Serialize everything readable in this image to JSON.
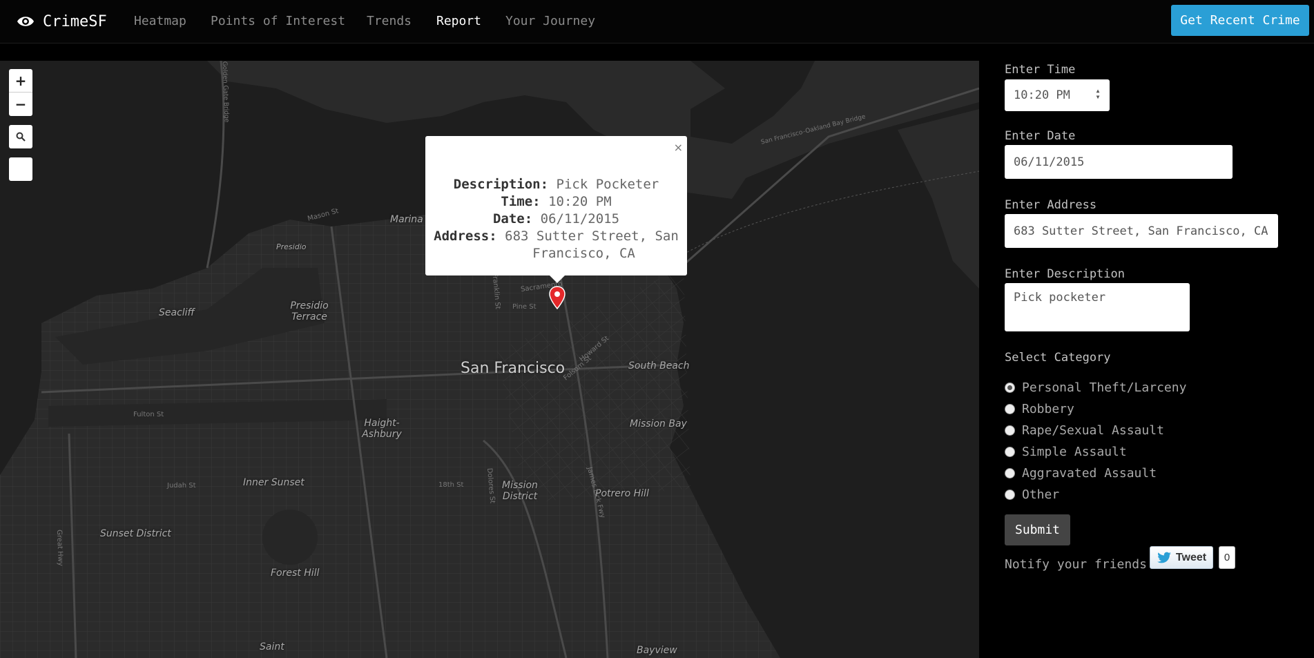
{
  "app": {
    "brand": "CrimeSF"
  },
  "nav": {
    "items": [
      {
        "label": "Heatmap",
        "active": false
      },
      {
        "label": "Points of Interest",
        "active": false
      },
      {
        "label": "Trends",
        "active": false
      },
      {
        "label": "Report",
        "active": true
      },
      {
        "label": "Your Journey",
        "active": false
      }
    ],
    "recent_button": "Get Recent Crime"
  },
  "map": {
    "controls": {
      "zoom_in": "+",
      "zoom_out": "−"
    },
    "labels": {
      "city": "San Francisco",
      "areas": [
        "Marina",
        "Presidio",
        "Seacliff",
        "Presidio Terrace",
        "Haight-Ashbury",
        "Inner Sunset",
        "Sunset District",
        "Forest Hill",
        "Mission District",
        "Potrero Hill",
        "South Beach",
        "Mission Bay",
        "Bayview",
        "Saint"
      ],
      "streets": [
        "Mason St",
        "Fulton St",
        "Judah St",
        "18th St",
        "Dolores St",
        "Franklin St",
        "Pine St",
        "Sacramento",
        "Howard St",
        "Folsom St",
        "James Lick Fwy",
        "San Francisco–Oakland Bay Bridge",
        "Golden Gate Bridge",
        "Great Hwy"
      ]
    },
    "popup": {
      "description_label": "Description:",
      "description": "Pick Pocketer",
      "time_label": "Time:",
      "time": "10:20 PM",
      "date_label": "Date:",
      "date": "06/11/2015",
      "address_label": "Address:",
      "address_line1": "683 Sutter Street, San",
      "address_line2": "Francisco, CA",
      "close": "×"
    }
  },
  "form": {
    "time_label": "Enter Time",
    "time_value": "10:20 PM",
    "date_label": "Enter Date",
    "date_value": "06/11/2015",
    "address_label": "Enter Address",
    "address_value": "683 Sutter Street, San Francisco, CA",
    "description_label": "Enter Description",
    "description_value": "Pick pocketer",
    "category_label": "Select Category",
    "categories": [
      {
        "label": "Personal Theft/Larceny",
        "checked": true
      },
      {
        "label": "Robbery",
        "checked": false
      },
      {
        "label": "Rape/Sexual Assault",
        "checked": false
      },
      {
        "label": "Simple Assault",
        "checked": false
      },
      {
        "label": "Aggravated Assault",
        "checked": false
      },
      {
        "label": "Other",
        "checked": false
      }
    ],
    "submit": "Submit",
    "notify_text": "Notify your friends",
    "tweet_label": "Tweet",
    "tweet_count": "0"
  },
  "colors": {
    "accent": "#2a9fd6",
    "map_bg": "#232323",
    "pin": "#e4282a"
  }
}
